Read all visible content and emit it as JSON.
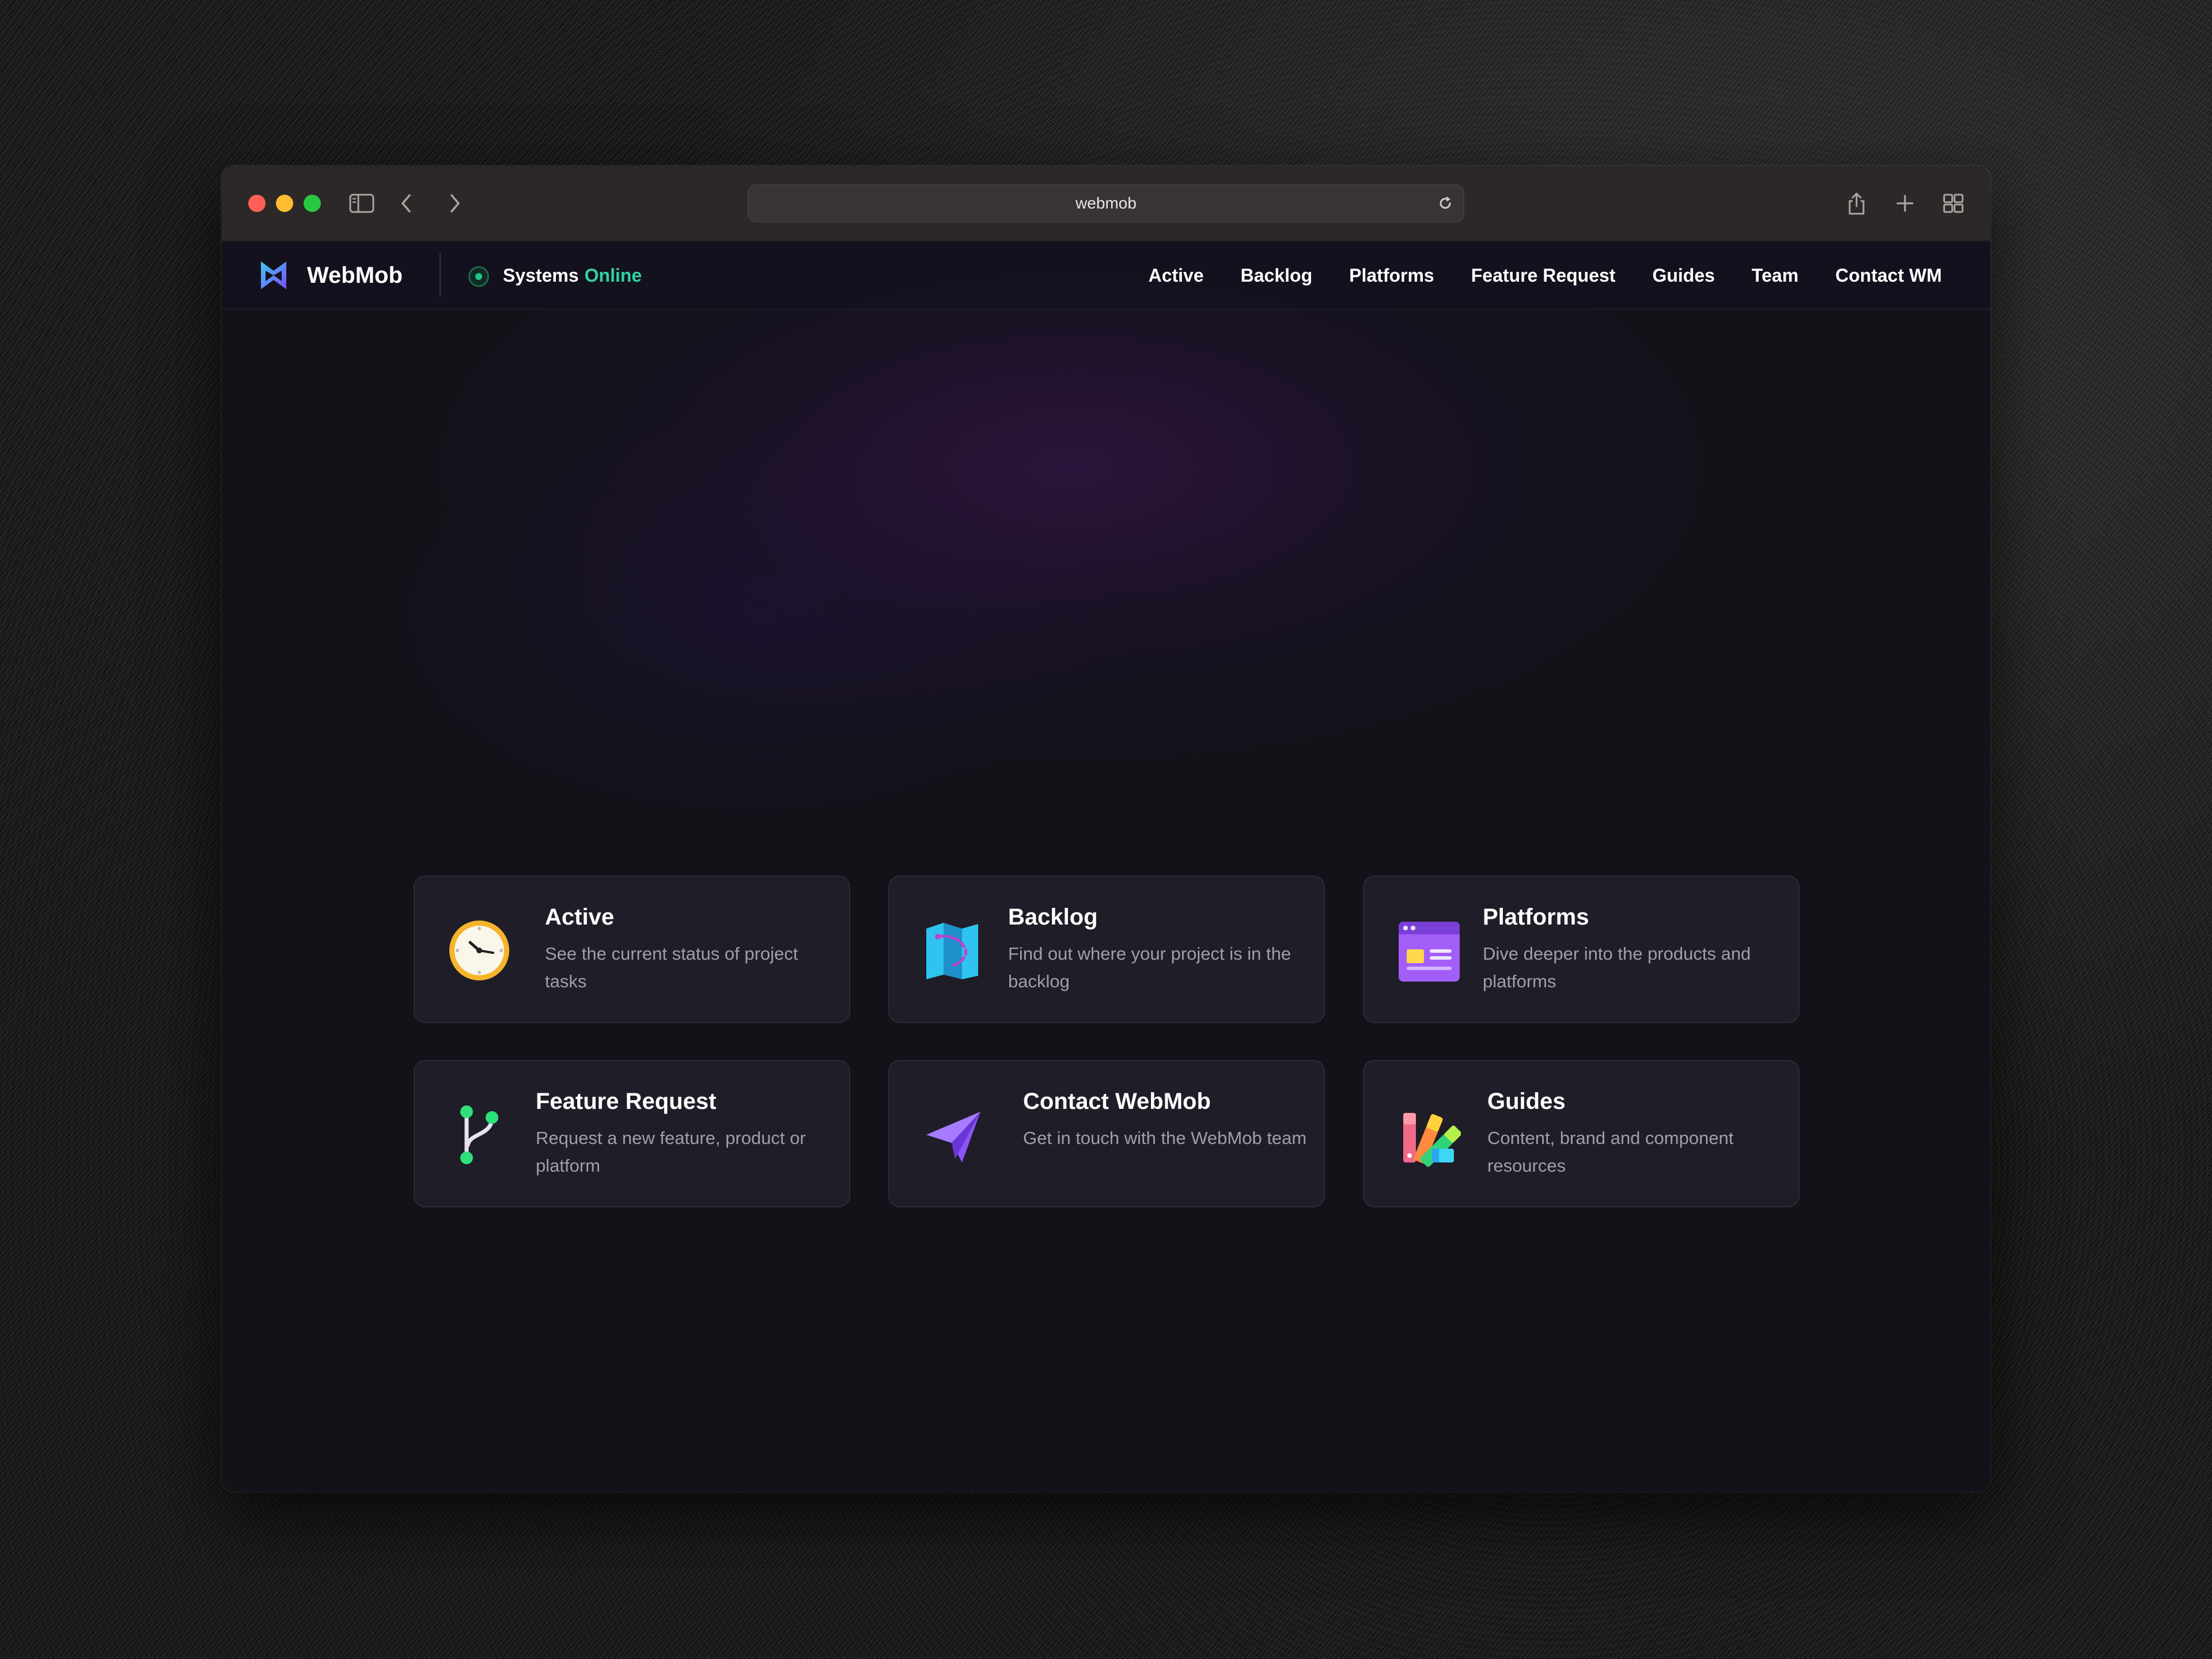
{
  "browser": {
    "url": "webmob"
  },
  "site": {
    "brand": "WebMob",
    "status": {
      "label": "Systems",
      "state": "Online"
    },
    "nav": [
      {
        "label": "Active"
      },
      {
        "label": "Backlog"
      },
      {
        "label": "Platforms"
      },
      {
        "label": "Feature Request"
      },
      {
        "label": "Guides"
      },
      {
        "label": "Team"
      },
      {
        "label": "Contact WM"
      }
    ],
    "cards": [
      {
        "title": "Active",
        "description": "See the current status of project tasks",
        "icon": "clock-icon"
      },
      {
        "title": "Backlog",
        "description": "Find out where your project is in the backlog",
        "icon": "map-icon"
      },
      {
        "title": "Platforms",
        "description": "Dive deeper into the products and platforms",
        "icon": "browser-window-icon"
      },
      {
        "title": "Feature Request",
        "description": "Request a new feature, product or platform",
        "icon": "git-branch-icon"
      },
      {
        "title": "Contact WebMob",
        "description": "Get in touch with the WebMob team",
        "icon": "paper-plane-icon"
      },
      {
        "title": "Guides",
        "description": "Content, brand and component resources",
        "icon": "color-swatches-icon"
      }
    ]
  },
  "colors": {
    "accent_online": "#2ed4a0",
    "page_background": "#131219",
    "card_background": "#1f1d27"
  }
}
